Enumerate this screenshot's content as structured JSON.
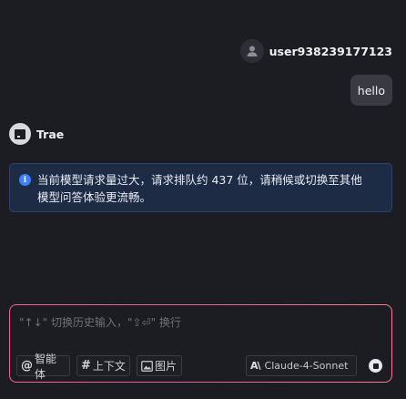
{
  "user": {
    "icon": "user-icon",
    "name": "user938239177123",
    "message": "hello"
  },
  "assistant": {
    "icon": "trae-logo-icon",
    "name": "Trae",
    "notice": {
      "icon": "info-icon",
      "text_line1": "当前模型请求量过大，请求排队约 437 位，请稍候或切换至其他",
      "text_line2": "模型问答体验更流畅。"
    }
  },
  "composer": {
    "placeholder": "\"↑↓\" 切换历史输入，\"⇧⏎\" 换行",
    "agent_symbol": "@",
    "agent_label": "智能体",
    "context_symbol": "#",
    "context_label": "上下文",
    "image_icon": "image-icon",
    "image_label": "图片",
    "model_icon": "anthropic-icon",
    "model_label": "Claude-4-Sonnet",
    "stop_icon": "stop-icon"
  },
  "colors": {
    "background": "#1c1d22",
    "bubble": "#3a3b42",
    "notice_bg": "#1d2b45",
    "notice_border": "#2c4270",
    "info_blue": "#3b82f6",
    "composer_border_gradient": [
      "#ff5ea0",
      "#ff7a8c"
    ]
  }
}
